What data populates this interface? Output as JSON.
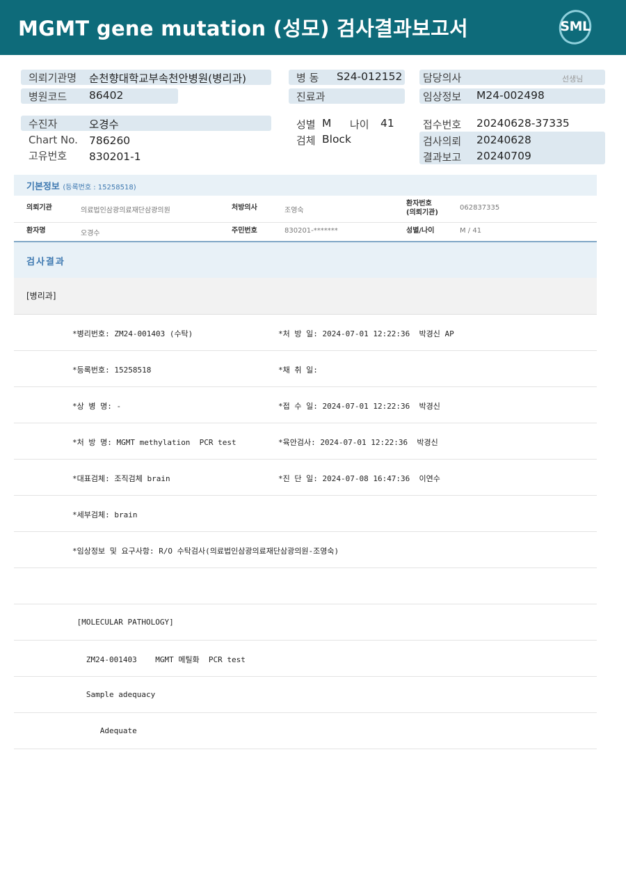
{
  "header": {
    "title": "MGMT gene mutation (성모) 검사결과보고서",
    "logo_text": "SML"
  },
  "info": {
    "requester_label": "의뢰기관명",
    "requester_value": "순천향대학교부속천안병원(병리과)",
    "hospital_code_label": "병원코드",
    "hospital_code_value": "86402",
    "ward_label": "병 동",
    "ward_value": "S24-012152",
    "department_label": "진료과",
    "department_value": "",
    "doctor_label": "담당의사",
    "doctor_value": "",
    "doctor_suffix": "선생님",
    "clinical_label": "임상정보",
    "clinical_value": "M24-002498",
    "patient_label": "수진자",
    "patient_value": "오경수",
    "chart_label": "Chart No.",
    "chart_value": "786260",
    "unique_label": "고유번호",
    "unique_value": "830201-1",
    "sex_label": "성별",
    "sex_value": "M",
    "age_label": "나이",
    "age_value": "41",
    "specimen_label": "검체",
    "specimen_value": "Block",
    "receipt_label": "접수번호",
    "receipt_value": "20240628-37335",
    "request_label": "검사의뢰",
    "request_value": "20240628",
    "report_label": "결과보고",
    "report_value": "20240709"
  },
  "basic": {
    "title": "기본정보",
    "subtitle": "(등록번호 : 15258518)",
    "inst_label": "의뢰기관",
    "inst_value": "의료법인삼광의료재단삼광의원",
    "presc_label": "처방의사",
    "presc_value": "조영숙",
    "pt_no_label_1": "환자번호",
    "pt_no_label_2": "(의뢰기관)",
    "pt_no_value": "062837335",
    "name_label": "환자명",
    "name_value": "오경수",
    "rrn_label": "주민번호",
    "rrn_value": "830201-*******",
    "sexage_label": "성별/나이",
    "sexage_value": "M / 41"
  },
  "result": {
    "title": "검사결과",
    "dept": "[병리과]",
    "rows": [
      {
        "left": "*병리번호: ZM24-001403 (수탁)",
        "right": "*처 방 일: 2024-07-01 12:22:36  박경신 AP"
      },
      {
        "left": "*등록번호: 15258518",
        "right": "*채 취 일:"
      },
      {
        "left": "*상 병 명: -",
        "right": "*접 수 일: 2024-07-01 12:22:36  박경신"
      },
      {
        "left": "*처 방 명: MGMT methylation  PCR test",
        "right": "*육안검사: 2024-07-01 12:22:36  박경신"
      },
      {
        "left": "*대표검체: 조직검체 brain",
        "right": "*진 단 일: 2024-07-08 16:47:36  이연수"
      },
      {
        "left": "*세부검체: brain",
        "right": ""
      },
      {
        "left": "*임상정보 및 요구사항: R/O 수탁검사(의료법인삼광의료재단삼광의원-조영숙)",
        "right": ""
      },
      {
        "left": "",
        "right": ""
      },
      {
        "left": " [MOLECULAR PATHOLOGY]",
        "right": ""
      },
      {
        "left": "   ZM24-001403    MGMT 메틸화  PCR test",
        "right": ""
      },
      {
        "left": "   Sample adequacy",
        "right": ""
      },
      {
        "left": "      Adequate",
        "right": ""
      }
    ]
  }
}
